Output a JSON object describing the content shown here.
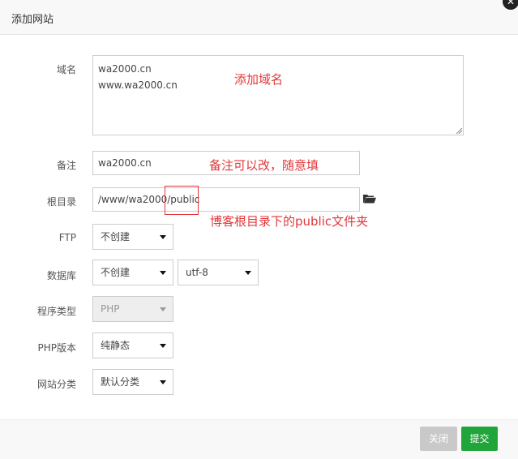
{
  "dialog": {
    "title": "添加网站",
    "close_icon": "close-icon"
  },
  "form": {
    "domain": {
      "label": "域名",
      "lines": [
        "wa2000.cn",
        "www.wa2000.cn"
      ]
    },
    "remark": {
      "label": "备注",
      "value": "wa2000.cn"
    },
    "root": {
      "label": "根目录",
      "value": "/www/wa2000/public",
      "icon": "folder-open-icon"
    },
    "ftp": {
      "label": "FTP",
      "selected": "不创建"
    },
    "database": {
      "label": "数据库",
      "selected": "不创建",
      "charset": "utf-8"
    },
    "program_type": {
      "label": "程序类型",
      "selected": "PHP"
    },
    "php_version": {
      "label": "PHP版本",
      "selected": "纯静态"
    },
    "category": {
      "label": "网站分类",
      "selected": "默认分类"
    }
  },
  "annotations": {
    "domain_note": "添加域名",
    "remark_note": "备注可以改，随意填",
    "root_note": "博客根目录下的public文件夹",
    "color": "#e2373a"
  },
  "footer": {
    "close_label": "关闭",
    "submit_label": "提交",
    "submit_color": "#20a53a",
    "close_color": "#c9c9c9"
  }
}
